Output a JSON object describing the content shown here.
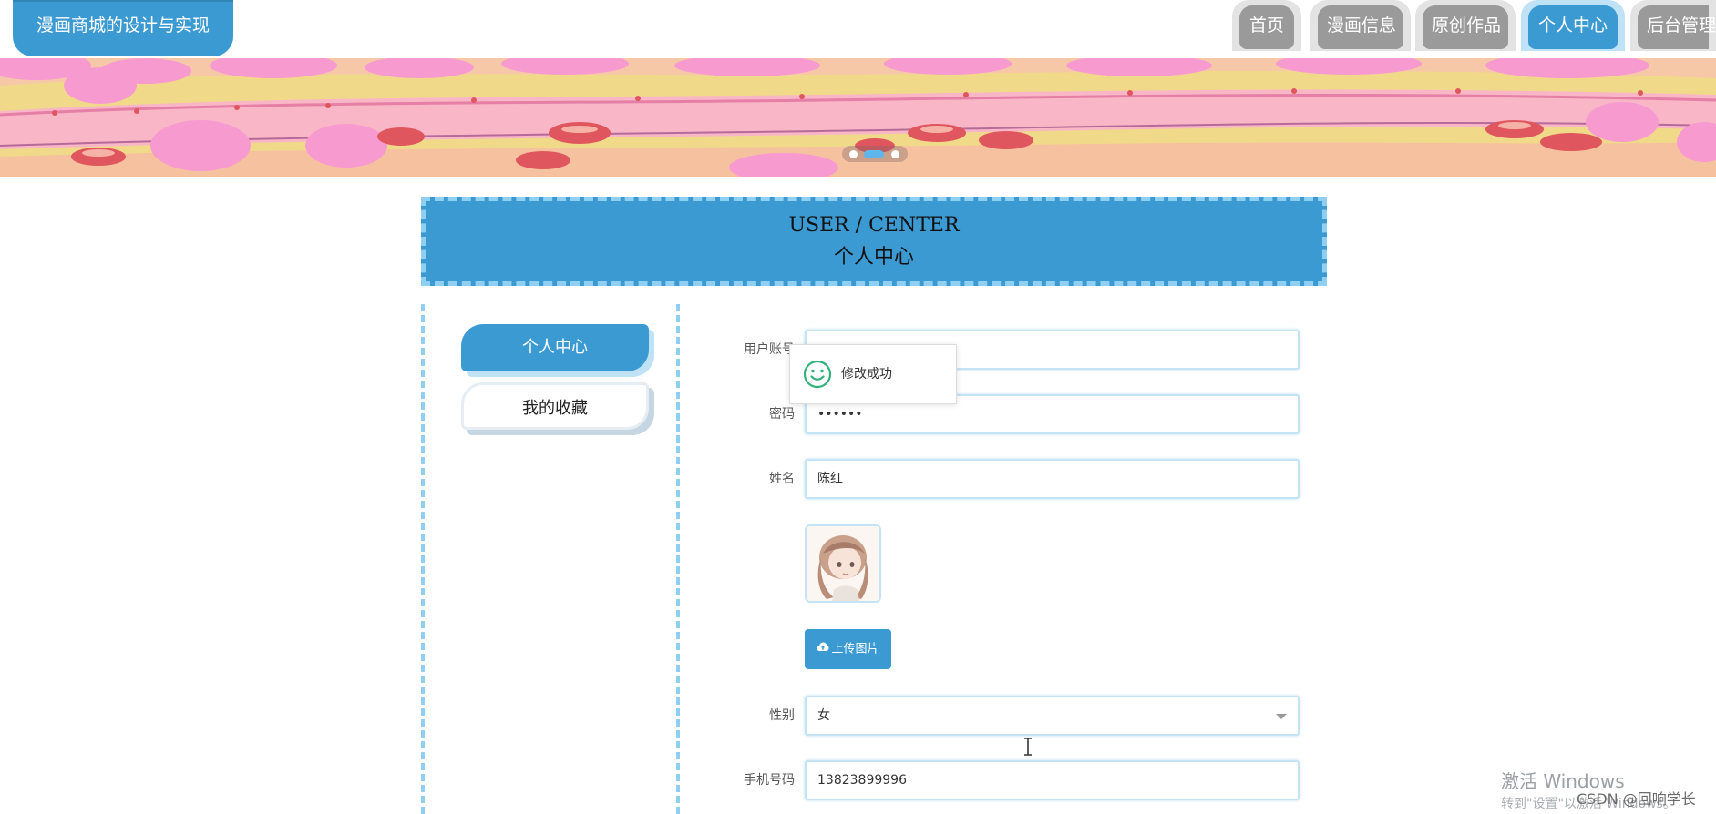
{
  "header": {
    "site_title": "漫画商城的设计与实现",
    "nav": [
      {
        "label": "首页",
        "active": false
      },
      {
        "label": "漫画信息",
        "active": false
      },
      {
        "label": "原创作品",
        "active": false
      },
      {
        "label": "个人中心",
        "active": true
      },
      {
        "label": "后台管理",
        "active": false
      }
    ]
  },
  "banner": {
    "icon": "cartoon-landscape-banner",
    "carousel_dots": 3,
    "active_dot": 2
  },
  "section": {
    "title_en": "USER / CENTER",
    "title_zh": "个人中心"
  },
  "sidebar": {
    "items": [
      {
        "label": "个人中心",
        "active": true
      },
      {
        "label": "我的收藏",
        "active": false
      }
    ]
  },
  "form": {
    "account_label": "用户账号",
    "account_value": "",
    "password_label": "密码",
    "password_value": "••••••",
    "name_label": "姓名",
    "name_value": "陈红",
    "upload_label": "上传图片",
    "gender_label": "性别",
    "gender_value": "女",
    "phone_label": "手机号码",
    "phone_value": "13823899996"
  },
  "toast": {
    "message": "修改成功",
    "icon": "smile-icon"
  },
  "watermark": {
    "title": "激活 Windows",
    "subtitle": "转到\"设置\"以激活 Windows。",
    "credit": "CSDN @回响学长"
  },
  "colors": {
    "accent": "#3c9ad2",
    "dashed_border": "#8fd0f2",
    "nav_inactive": "#9a9a9a",
    "success": "#2fb37a"
  }
}
